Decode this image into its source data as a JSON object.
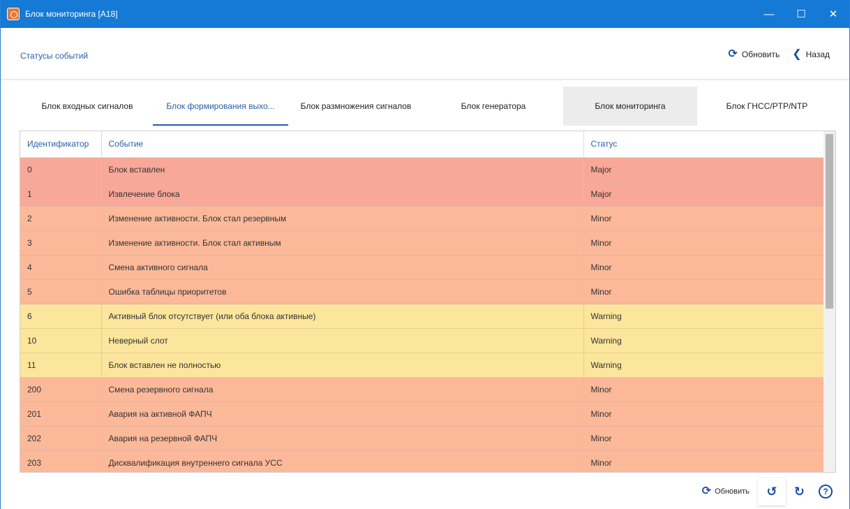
{
  "window": {
    "title": "Блок мониторинга [A18]",
    "controls": {
      "minimize": "—",
      "maximize": "☐",
      "close": "✕"
    }
  },
  "header": {
    "breadcrumb": "Статусы событий",
    "refresh_label": "Обновить",
    "back_label": "Назад"
  },
  "tabs": [
    {
      "label": "Блок входных сигналов",
      "state": "normal"
    },
    {
      "label": "Блок формирования выхо...",
      "state": "active"
    },
    {
      "label": "Блок размножения сигналов",
      "state": "normal"
    },
    {
      "label": "Блок генератора",
      "state": "normal"
    },
    {
      "label": "Блок мониторинга",
      "state": "highlight"
    },
    {
      "label": "Блок ГНСС/PTP/NTP",
      "state": "normal"
    }
  ],
  "table": {
    "columns": [
      "Идентификатор",
      "Событие",
      "Статус"
    ],
    "rows": [
      {
        "id": "0",
        "event": "Блок вставлен",
        "status": "Major"
      },
      {
        "id": "1",
        "event": "Извлечение блока",
        "status": "Major"
      },
      {
        "id": "2",
        "event": "Изменение активности. Блок стал резервным",
        "status": "Minor"
      },
      {
        "id": "3",
        "event": "Изменение активности. Блок стал активным",
        "status": "Minor"
      },
      {
        "id": "4",
        "event": "Смена активного сигнала",
        "status": "Minor"
      },
      {
        "id": "5",
        "event": "Ошибка таблицы приоритетов",
        "status": "Minor"
      },
      {
        "id": "6",
        "event": "Активный блок отсутствует (или оба блока активные)",
        "status": "Warning"
      },
      {
        "id": "10",
        "event": "Неверный слот",
        "status": "Warning"
      },
      {
        "id": "11",
        "event": "Блок вставлен не полностью",
        "status": "Warning"
      },
      {
        "id": "200",
        "event": "Смена резервного сигнала",
        "status": "Minor"
      },
      {
        "id": "201",
        "event": "Авария на активной ФАПЧ",
        "status": "Minor"
      },
      {
        "id": "202",
        "event": "Авария на резервной ФАПЧ",
        "status": "Minor"
      },
      {
        "id": "203",
        "event": "Дисквалификация внутреннего сигнала УСС",
        "status": "Minor"
      }
    ]
  },
  "footer": {
    "refresh_label": "Обновить"
  },
  "colors": {
    "titlebar": "#1579d6",
    "accent": "#2a5da8",
    "major": "#f8a898",
    "minor": "#fbb99a",
    "warning": "#fce59c"
  },
  "icons": {
    "app": "monitoring-app-icon",
    "refresh": "refresh-icon",
    "back": "chevron-left-icon",
    "undo": "undo-icon",
    "redo": "redo-icon",
    "help": "help-icon"
  }
}
